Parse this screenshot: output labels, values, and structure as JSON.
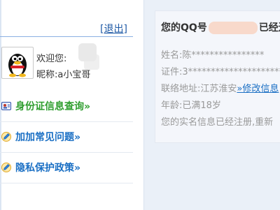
{
  "sidebar": {
    "logout_label": "[退出]",
    "welcome_label": "欢迎您:",
    "nickname_label": "昵称:",
    "nickname_value": "a小宝哥",
    "menu": [
      {
        "label": "身份证信息查询»",
        "icon": "id-card-icon",
        "color": "#2f9e2f"
      },
      {
        "label": "加加常见问题»",
        "icon": "pencil-icon",
        "color": "#1a6fc4"
      },
      {
        "label": "隐私保护政策»",
        "icon": "pencil-icon",
        "color": "#1a6fc4"
      }
    ]
  },
  "panel": {
    "title_prefix": "您的QQ号",
    "title_suffix": "已经进",
    "name": "姓名:陈****************",
    "id_card": "证件:3*********************",
    "address_prefix": "联络地址:江苏淮安",
    "address_link": "»修改信息",
    "age": "年龄:已满18岁",
    "notice": "您的实名信息已经注册,重新"
  },
  "colors": {
    "background": "#eaf0f8",
    "link_blue": "#1f5aa6",
    "menu_green": "#2f9e2f",
    "menu_blue": "#1a6fc4"
  }
}
